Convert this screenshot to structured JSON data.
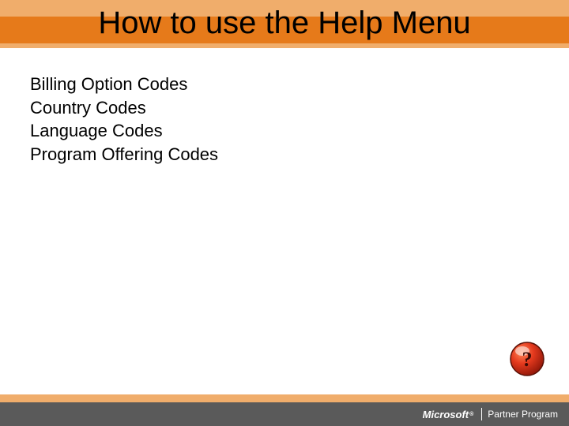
{
  "title": "How to use the Help Menu",
  "body_items": [
    "Billing Option Codes",
    "Country Codes",
    "Language Codes",
    "Program Offering Codes"
  ],
  "help_icon_label": "?",
  "footer": {
    "brand": "Microsoft",
    "reg": "®",
    "program": "Partner Program"
  },
  "colors": {
    "band_light": "#f0ad6b",
    "band_dark": "#e67a1a",
    "footer_dark": "#5a5a5a"
  }
}
